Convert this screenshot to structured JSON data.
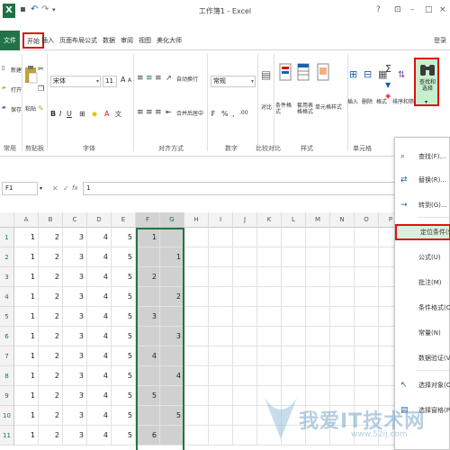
{
  "window": {
    "title": "工作簿1 - Excel",
    "logo": "X",
    "controls": [
      "?",
      "⊡",
      "–",
      "□",
      "×"
    ]
  },
  "tabs": {
    "file": "文件",
    "items": [
      "开始",
      "插入",
      "页面布局",
      "公式",
      "数据",
      "审阅",
      "视图",
      "美化大师"
    ],
    "login": "登录"
  },
  "ribbon": {
    "clipboard": {
      "new": "新建",
      "open": "打开",
      "save": "保存",
      "paste": "粘贴"
    },
    "font_name": "宋体",
    "font_size": "11",
    "wrap_text": "自动换行",
    "merge_center": "合并后居中",
    "number_format": "常规",
    "insert": "插入",
    "delete": "删除",
    "format": "格式",
    "sort_filter": "排序和筛选",
    "find_select": "查找和选择",
    "cond_format": "条件格式",
    "table_format": "套用表格格式",
    "cell_styles": "单元格样式",
    "compare": "对比",
    "groups": [
      "常用",
      "剪贴板",
      "字体",
      "对齐方式",
      "数字",
      "比较对比",
      "样式",
      "单元格"
    ]
  },
  "formula_bar": {
    "name_box": "F1",
    "value": "1",
    "fx": "fx"
  },
  "sheet": {
    "columns": [
      "A",
      "B",
      "C",
      "D",
      "E",
      "F",
      "G",
      "H",
      "I",
      "J",
      "K",
      "L",
      "M",
      "N",
      "O",
      "P",
      "Q"
    ],
    "rows": [
      {
        "num": "1",
        "cells": [
          "1",
          "2",
          "3",
          "4",
          "5",
          "1",
          ""
        ]
      },
      {
        "num": "2",
        "cells": [
          "1",
          "2",
          "3",
          "4",
          "5",
          "",
          "1"
        ]
      },
      {
        "num": "3",
        "cells": [
          "1",
          "2",
          "3",
          "4",
          "5",
          "2",
          ""
        ]
      },
      {
        "num": "4",
        "cells": [
          "1",
          "2",
          "3",
          "4",
          "5",
          "",
          "2"
        ]
      },
      {
        "num": "5",
        "cells": [
          "1",
          "2",
          "3",
          "4",
          "5",
          "3",
          ""
        ]
      },
      {
        "num": "6",
        "cells": [
          "1",
          "2",
          "3",
          "4",
          "5",
          "",
          "3"
        ]
      },
      {
        "num": "7",
        "cells": [
          "1",
          "2",
          "3",
          "4",
          "5",
          "4",
          ""
        ]
      },
      {
        "num": "8",
        "cells": [
          "1",
          "2",
          "3",
          "4",
          "5",
          "",
          "4"
        ]
      },
      {
        "num": "9",
        "cells": [
          "1",
          "2",
          "3",
          "4",
          "5",
          "5",
          ""
        ]
      },
      {
        "num": "10",
        "cells": [
          "1",
          "2",
          "3",
          "4",
          "5",
          "",
          "5"
        ]
      },
      {
        "num": "11",
        "cells": [
          "1",
          "2",
          "3",
          "4",
          "5",
          "6",
          ""
        ]
      }
    ]
  },
  "menu": {
    "items": [
      "查找(F)...",
      "替换(R)...",
      "转到(G)...",
      "定位条件(S)...",
      "公式(U)",
      "批注(M)",
      "条件格式(C)",
      "常量(N)",
      "数据验证(V)",
      "选择对象(O)",
      "选择窗格(P)..."
    ],
    "highlighted_index": 3
  },
  "watermark": {
    "text": "我爱IT技术网",
    "url": "www.52ij.com"
  },
  "colors": {
    "excel_green": "#217346",
    "highlight_red": "#dd1111",
    "selection_gray": "#d0d0d0"
  }
}
